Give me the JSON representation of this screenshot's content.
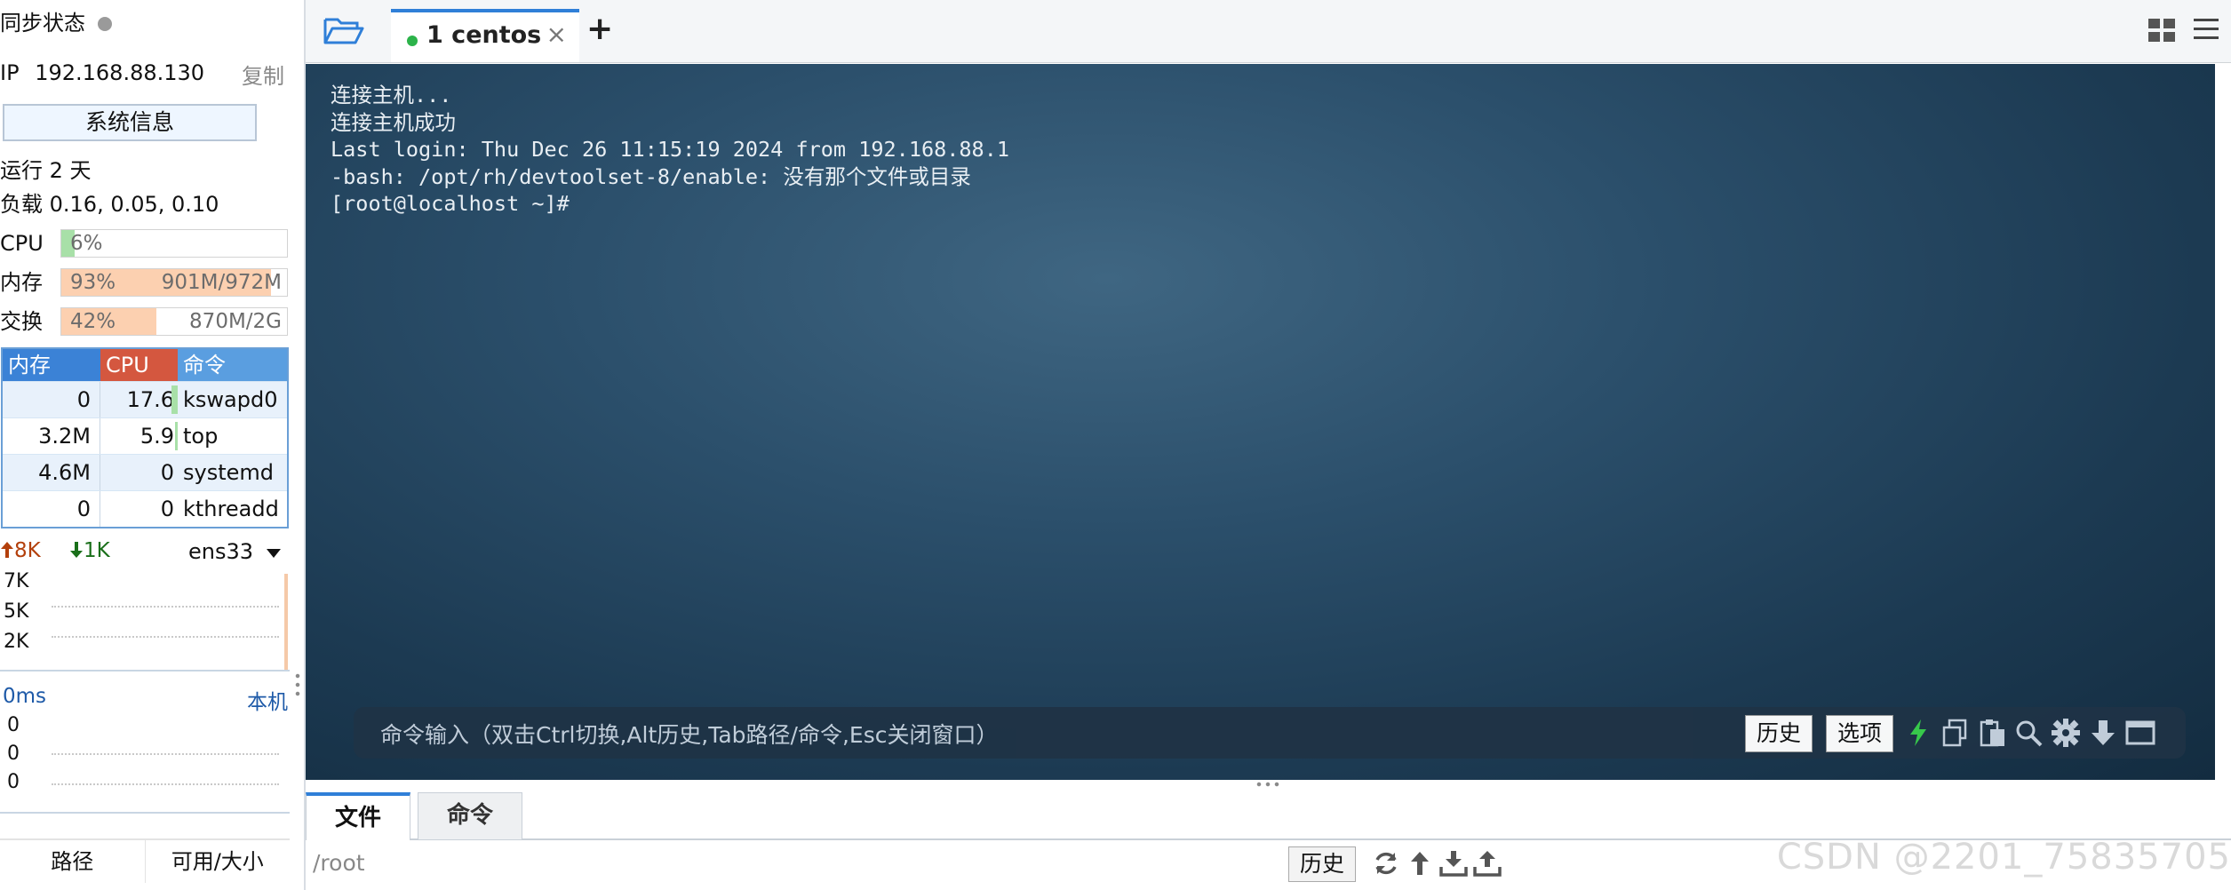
{
  "sidebar": {
    "sync_label": "同步状态",
    "ip_label": "IP",
    "ip_value": "192.168.88.130",
    "copy_label": "复制",
    "sysinfo_button": "系统信息",
    "uptime": "运行 2 天",
    "load": "负载 0.16, 0.05, 0.10",
    "meters": [
      {
        "label": "CPU",
        "percent": "6%",
        "fraction": 0.06,
        "detail": "",
        "color": "#a8e0a8"
      },
      {
        "label": "内存",
        "percent": "93%",
        "fraction": 0.93,
        "detail": "901M/972M",
        "color": "#fcd0b0"
      },
      {
        "label": "交换",
        "percent": "42%",
        "fraction": 0.42,
        "detail": "870M/2G",
        "color": "#fcd0b0"
      }
    ],
    "process_table": {
      "headers": {
        "mem": "内存",
        "cpu": "CPU",
        "cmd": "命令"
      },
      "header_colors": {
        "mem": "#3b82d6",
        "cpu": "#d4573f",
        "cmd": "#5a9ee0"
      },
      "rows": [
        {
          "mem": "0",
          "cpu": "17.6",
          "cmd": "kswapd0"
        },
        {
          "mem": "3.2M",
          "cpu": "5.9",
          "cmd": "top"
        },
        {
          "mem": "4.6M",
          "cpu": "0",
          "cmd": "systemd"
        },
        {
          "mem": "0",
          "cpu": "0",
          "cmd": "kthreadd"
        }
      ]
    },
    "network": {
      "up": "8K",
      "down": "1K",
      "interface": "ens33",
      "y_ticks": [
        "7K",
        "5K",
        "2K"
      ]
    },
    "ping": {
      "latency": "0ms",
      "target": "本机",
      "y_ticks": [
        "0",
        "0",
        "0"
      ]
    },
    "disk_headers": {
      "path": "路径",
      "size": "可用/大小"
    }
  },
  "tabs": [
    {
      "label": "1 centos",
      "status_color": "#2cb34a"
    }
  ],
  "terminal": {
    "lines": [
      "连接主机...",
      "连接主机成功",
      "Last login: Thu Dec 26 11:15:19 2024 from 192.168.88.1",
      "-bash: /opt/rh/devtoolset-8/enable: 没有那个文件或目录",
      "[root@localhost ~]#"
    ],
    "command_hint": "命令输入（双击Ctrl切换,Alt历史,Tab路径/命令,Esc关闭窗口）",
    "history_button": "历史",
    "options_button": "选项"
  },
  "file_panel": {
    "tabs": [
      "文件",
      "命令"
    ],
    "path": "/root",
    "history_button": "历史"
  },
  "watermark": "CSDN @2201_75835705"
}
